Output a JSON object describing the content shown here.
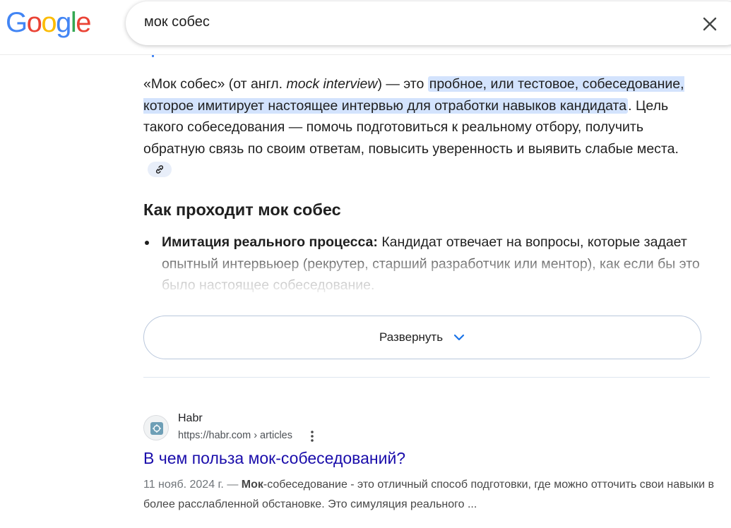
{
  "header": {
    "logo_letters": [
      "G",
      "o",
      "o",
      "g",
      "l",
      "e"
    ],
    "search_value": "мок собес"
  },
  "overview": {
    "para_part1": "«Мок собес» (от англ. ",
    "para_em": "mock interview",
    "para_part2": ") — это ",
    "para_highlight": "пробное, или тестовое, собеседование, которое имитирует настоящее интервью для отработки навыков кандидата",
    "para_part3": ". Цель такого собеседования — помочь подготовиться к реальному отбору, получить обратную связь по своим ответам, повысить уверенность и выявить слабые места.",
    "section_title": "Как проходит мок собес",
    "bullet_bold": "Имитация реального процесса:",
    "bullet_text": " Кандидат отвечает на вопросы, которые задает опытный интервьюер (рекрутер, старший разработчик или ментор), как если бы это было настоящее собеседование.",
    "expand_label": "Развернуть"
  },
  "result": {
    "site_name": "Habr",
    "url": "https://habr.com › articles",
    "title": "В чем польза мок-собеседований?",
    "date": "11 нояб. 2024 г. — ",
    "snippet_bold": "Мок",
    "snippet_rest": "-собеседование - это отличный способ подготовки, где можно отточить свои навыки в более расслабленной обстановке. Это симуляция реального ..."
  },
  "colors": {
    "link": "#1a0dab",
    "highlight": "#d3e3fd",
    "accent": "#1a73e8"
  }
}
